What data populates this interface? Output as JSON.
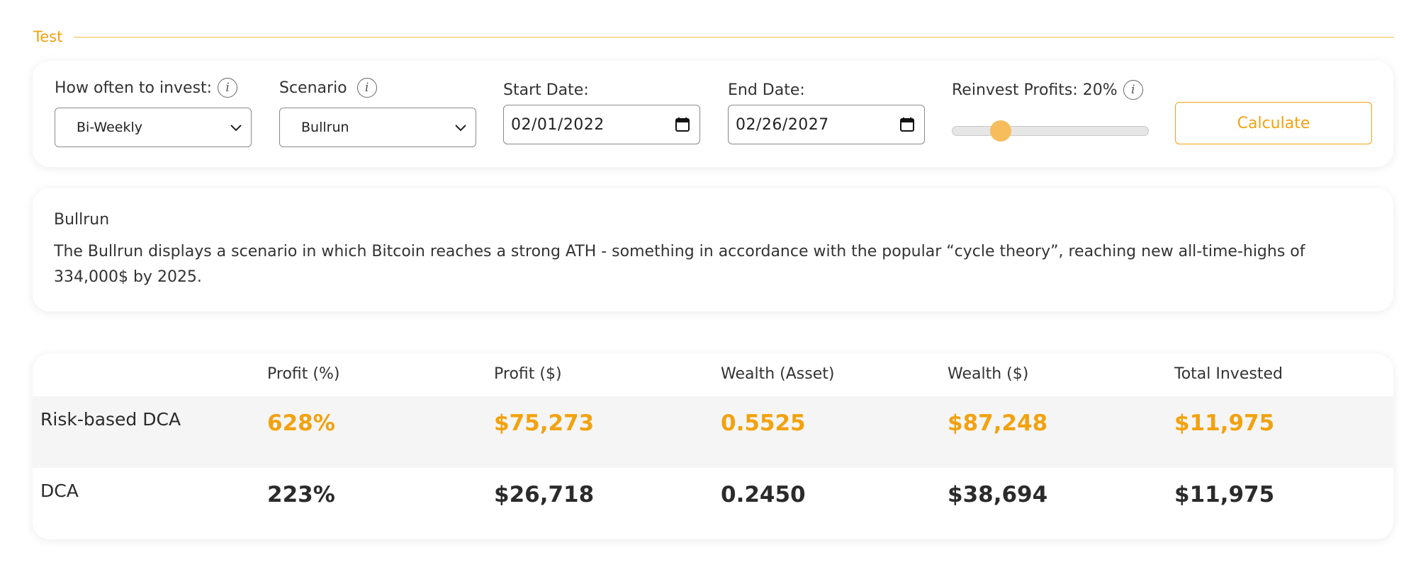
{
  "section": {
    "title": "Test"
  },
  "controls": {
    "frequency": {
      "label": "How often to invest:",
      "value": "Bi-Weekly"
    },
    "scenario": {
      "label": "Scenario",
      "value": "Bullrun"
    },
    "start_date": {
      "label": "Start Date:",
      "value": "02/01/2022"
    },
    "end_date": {
      "label": "End Date:",
      "value": "02/26/2027"
    },
    "reinvest": {
      "label": "Reinvest Profits: 20%",
      "value_percent": 20
    },
    "calculate_label": "Calculate"
  },
  "description": {
    "title": "Bullrun",
    "text": "The Bullrun displays a scenario in which Bitcoin reaches a strong ATH - something in accordance with the popular “cycle theory”, reaching new all-time-highs of 334,000$ by 2025."
  },
  "results": {
    "headers": [
      "Profit (%)",
      "Profit ($)",
      "Wealth (Asset)",
      "Wealth ($)",
      "Total Invested"
    ],
    "rows": [
      {
        "label": "Risk-based DCA",
        "values": [
          "628%",
          "$75,273",
          "0.5525",
          "$87,248",
          "$11,975"
        ]
      },
      {
        "label": "DCA",
        "values": [
          "223%",
          "$26,718",
          "0.2450",
          "$38,694",
          "$11,975"
        ]
      }
    ]
  },
  "colors": {
    "accent": "#f2a20f",
    "slider_thumb": "#f7bd5c",
    "highlight_row": "#f5f5f5"
  },
  "icons": {
    "info": "info-icon",
    "dropdown": "chevron-down-icon",
    "calendar": "calendar-icon"
  }
}
